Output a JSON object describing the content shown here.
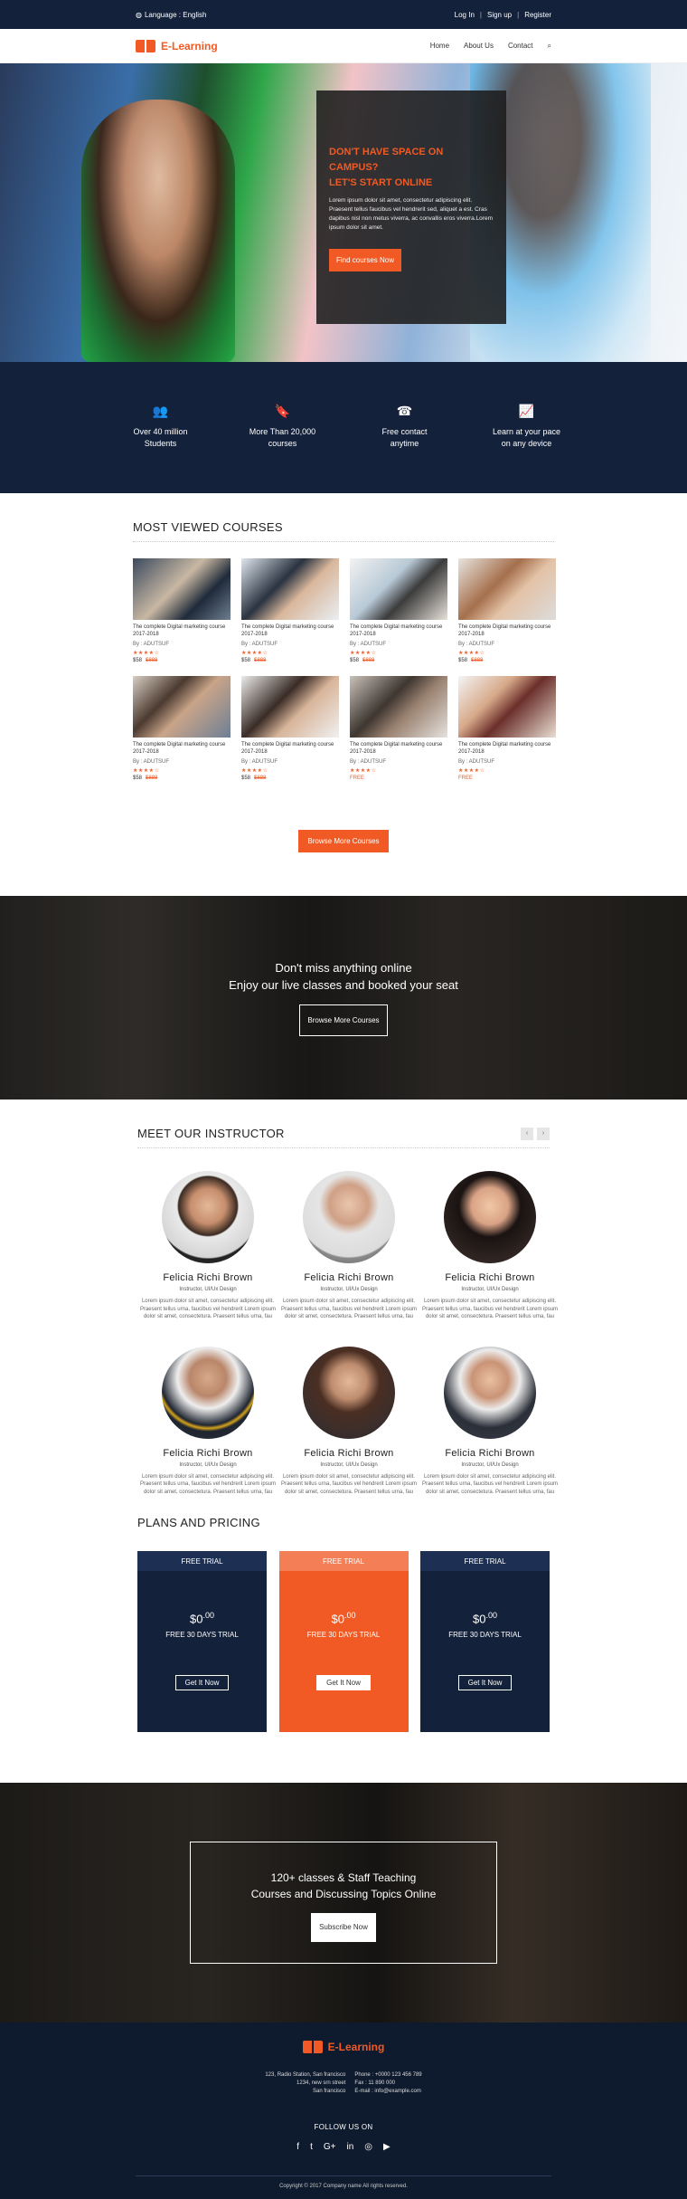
{
  "topbar": {
    "language": "Language : English",
    "login": "Log In",
    "signup": "Sign up",
    "register": "Register"
  },
  "brand": {
    "name": "E-Learning",
    "accent": "#f15a24",
    "navy": "#13213a"
  },
  "nav": {
    "items": [
      "Home",
      "About Us",
      "Contact"
    ]
  },
  "hero": {
    "title_line1": "DON'T HAVE SPACE ON CAMPUS?",
    "title_line2": "LET'S START ONLINE",
    "text": "Lorem ipsum dolor sit amet, consectetur adipiscing elit. Praesent tellus faucibus vel hendrerit sed, aliquet a est. Cras dapibus nisl non metus viverra, ac convallis eros viverra.Lorem ipsum dolor sit amet.",
    "cta": "Find courses Now"
  },
  "features": [
    {
      "icon": "users-icon",
      "line1": "Over 40 million",
      "line2": "Students"
    },
    {
      "icon": "bookmark-icon",
      "line1": "More Than 20,000",
      "line2": "courses"
    },
    {
      "icon": "phone-icon",
      "line1": "Free contact",
      "line2": "anytime"
    },
    {
      "icon": "chart-icon",
      "line1": "Learn at your pace",
      "line2": "on any device"
    }
  ],
  "courses": {
    "title": "MOST VIEWED COURSES",
    "items": [
      {
        "title": "The complete Digital marketing course 2017-2018",
        "by": "By : ADUTSUF",
        "stars": "★★★★☆",
        "price": "$58",
        "old": "$888"
      },
      {
        "title": "The complete Digital marketing course 2017-2018",
        "by": "By : ADUTSUF",
        "stars": "★★★★☆",
        "price": "$58",
        "old": "$888"
      },
      {
        "title": "The complete Digital marketing course 2017-2018",
        "by": "By : ADUTSUF",
        "stars": "★★★★☆",
        "price": "$58",
        "old": "$888"
      },
      {
        "title": "The complete Digital marketing course 2017-2018",
        "by": "By : ADUTSUF",
        "stars": "★★★★☆",
        "price": "$58",
        "old": "$888"
      },
      {
        "title": "The complete Digital marketing course 2017-2018",
        "by": "By : ADUTSUF",
        "stars": "★★★★☆",
        "price": "$58",
        "old": "$888"
      },
      {
        "title": "The complete Digital marketing course 2017-2018",
        "by": "By : ADUTSUF",
        "stars": "★★★★☆",
        "price": "$58",
        "old": "$888"
      },
      {
        "title": "The complete Digital marketing course 2017-2018",
        "by": "By : ADUTSUF",
        "stars": "★★★★☆",
        "price": "FREE",
        "old": ""
      },
      {
        "title": "The complete Digital marketing course 2017-2018",
        "by": "By : ADUTSUF",
        "stars": "★★★★☆",
        "price": "FREE",
        "old": ""
      }
    ],
    "browse": "Browse More Courses"
  },
  "banner": {
    "line1": "Don't miss anything online",
    "line2": "Enjoy our live classes and booked your seat",
    "cta": "Browse More Courses"
  },
  "instructors": {
    "title": "MEET OUR INSTRUCTOR",
    "prev": "‹",
    "next": "›",
    "items": [
      {
        "name": "Felicia Richi Brown",
        "role": "Instructor, UI/Ux Design",
        "bio": "Lorem ipsum dolor sit amet, consectetur adipiscing elit. Praesent tellus urna, faucibus vel hendrerit Lorem ipsum dolor sit amet, consectetura. Praesent tellus urna, fau"
      },
      {
        "name": "Felicia Richi Brown",
        "role": "Instructor, UI/Ux Design",
        "bio": "Lorem ipsum dolor sit amet, consectetur adipiscing elit. Praesent tellus urna, faucibus vel hendrerit Lorem ipsum dolor sit amet, consectetura. Praesent tellus urna, fau"
      },
      {
        "name": "Felicia Richi Brown",
        "role": "Instructor, UI/Ux Design",
        "bio": "Lorem ipsum dolor sit amet, consectetur adipiscing elit. Praesent tellus urna, faucibus vel hendrerit Lorem ipsum dolor sit amet, consectetura. Praesent tellus urna, fau"
      },
      {
        "name": "Felicia Richi Brown",
        "role": "Instructor, UI/Ux Design",
        "bio": "Lorem ipsum dolor sit amet, consectetur adipiscing elit. Praesent tellus urna, faucibus vel hendrerit Lorem ipsum dolor sit amet, consectetura. Praesent tellus urna, fau"
      },
      {
        "name": "Felicia Richi Brown",
        "role": "Instructor, UI/Ux Design",
        "bio": "Lorem ipsum dolor sit amet, consectetur adipiscing elit. Praesent tellus urna, faucibus vel hendrerit Lorem ipsum dolor sit amet, consectetura. Praesent tellus urna, fau"
      },
      {
        "name": "Felicia Richi Brown",
        "role": "Instructor, UI/Ux Design",
        "bio": "Lorem ipsum dolor sit amet, consectetur adipiscing elit. Praesent tellus urna, faucibus vel hendrerit Lorem ipsum dolor sit amet, consectetura. Praesent tellus urna, fau"
      }
    ]
  },
  "pricing": {
    "title": "PLANS AND PRICING",
    "plans": [
      {
        "head": "FREE TRIAL",
        "dollar": "$0",
        "cents": ".00",
        "sub": "FREE 30 DAYS TRIAL",
        "cta": "Get It Now"
      },
      {
        "head": "FREE TRIAL",
        "dollar": "$0",
        "cents": ".00",
        "sub": "FREE 30 DAYS TRIAL",
        "cta": "Get It Now"
      },
      {
        "head": "FREE TRIAL",
        "dollar": "$0",
        "cents": ".00",
        "sub": "FREE 30 DAYS TRIAL",
        "cta": "Get It Now"
      }
    ]
  },
  "subscribe": {
    "line1": "120+ classes & Staff Teaching",
    "line2": "Courses and Discussing Topics Online",
    "cta": "Subscribe Now"
  },
  "footer": {
    "address": [
      "123, Radio Station, San francisco",
      "1234, new srn street",
      "San francisco"
    ],
    "contact": [
      "Phone : +0000 123 456 789",
      "Fax : 11 890 000",
      "E-mail : info@example.com"
    ],
    "follow": "FOLLOW US ON",
    "socials": [
      "f",
      "t",
      "G+",
      "in",
      "◎",
      "▶"
    ],
    "copyright": "Copyright © 2017 Company name All rights reserved."
  }
}
